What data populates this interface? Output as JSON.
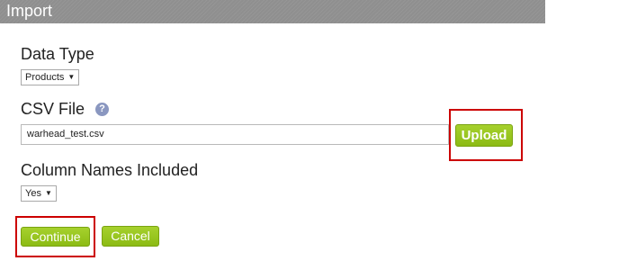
{
  "title": "Import",
  "data_type": {
    "label": "Data Type",
    "selected": "Products"
  },
  "csv_file": {
    "label": "CSV File",
    "help_glyph": "?",
    "value": "warhead_test.csv",
    "upload_label": "Upload"
  },
  "column_names": {
    "label": "Column Names Included",
    "selected": "Yes"
  },
  "actions": {
    "continue_label": "Continue",
    "cancel_label": "Cancel"
  },
  "colors": {
    "accent_green": "#8cbb14",
    "highlight_red": "#cc0000",
    "titlebar_gray": "#8f8f8f",
    "help_icon_blue": "#8a97c0"
  },
  "icons": {
    "help": "help-icon",
    "dropdown": "dropdown-arrow-icon"
  }
}
